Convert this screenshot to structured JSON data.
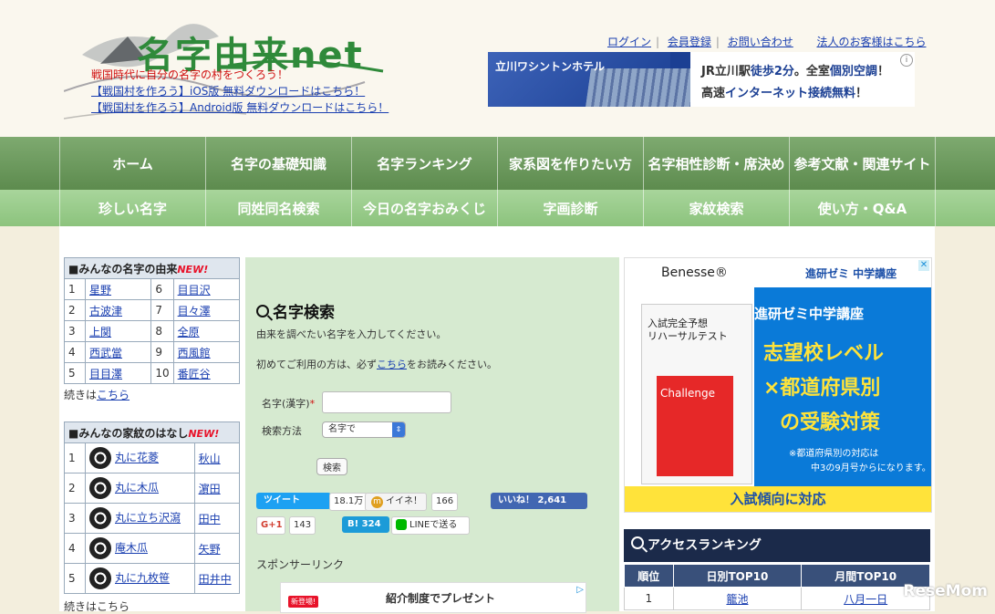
{
  "header": {
    "logo_text": "名字由来net",
    "promo_red": "戦国時代に自分の名字の村をつくろう！",
    "promo_ios": "【戦国村を作ろう】iOS版 無料ダウンロードはこちら！",
    "promo_android": "【戦国村を作ろう】Android版 無料ダウンロードはこちら！",
    "links": [
      "ログイン",
      "会員登録",
      "お問い合わせ",
      "法人のお客様はこちら"
    ],
    "banner": {
      "hotel": "立川ワシントンホテル",
      "line1_a": "JR立川駅",
      "line1_b": "徒歩2分",
      "line1_c": "。全室",
      "line1_d": "個別空調",
      "line1_e": "！",
      "line2_a": "高速",
      "line2_b": "インターネット接続無料",
      "line2_c": "！"
    }
  },
  "nav_main": [
    "ホーム",
    "名字の基礎知識",
    "名字ランキング",
    "家系図を作りたい方",
    "名字相性診断・席決め",
    "参考文献・関連サイト"
  ],
  "nav_sub": [
    "珍しい名字",
    "同姓同名検索",
    "今日の名字おみくじ",
    "字画診断",
    "家紋検索",
    "使い方・Q&A"
  ],
  "origins": {
    "title": "■みんなの名字の由来",
    "new_badge": "NEW!",
    "rows": [
      [
        "1",
        "星野",
        "6",
        "目目沢"
      ],
      [
        "2",
        "古波津",
        "7",
        "目々澤"
      ],
      [
        "3",
        "上関",
        "8",
        "全原"
      ],
      [
        "4",
        "西武當",
        "9",
        "西風館"
      ],
      [
        "5",
        "目目澤",
        "10",
        "番匠谷"
      ]
    ],
    "more": "続きは",
    "more_link": "こちら"
  },
  "kamon": {
    "title": "■みんなの家紋のはなし",
    "new_badge": "NEW!",
    "rows": [
      [
        "1",
        "丸に花菱",
        "秋山"
      ],
      [
        "2",
        "丸に木瓜",
        "濵田"
      ],
      [
        "3",
        "丸に立ち沢瀉",
        "田中"
      ],
      [
        "4",
        "庵木瓜",
        "矢野"
      ],
      [
        "5",
        "丸に九枚笹",
        "田井中"
      ]
    ],
    "more": "続きはこちら"
  },
  "search": {
    "title": "名字検索",
    "desc1": "由来を調べたい名字を入力してください。",
    "desc2_a": "初めてご利用の方は、必ず",
    "desc2_link": "こちら",
    "desc2_b": "をお読みください。",
    "label_name": "名字(漢字)",
    "required": "*",
    "label_method": "検索方法",
    "method_value": "名字で",
    "button": "検索"
  },
  "social": {
    "tweet": "ツイート",
    "tweet_count": "18.1万",
    "iine": "イイネ！",
    "iine_count": "166",
    "fb": "いいね！ 2,641",
    "gplus": "G+1",
    "gplus_count": "143",
    "hatena": "B! 324",
    "line": "LINEで送る"
  },
  "sponsor": {
    "label": "スポンサーリンク",
    "badge": "新登場!",
    "ad_text": "紹介制度でプレゼント"
  },
  "right_ad": {
    "benesse": "Benesse®",
    "shinken_top": "進研ゼミ 中学講座",
    "book1": "入試完全予想",
    "book2": "リハーサルテスト",
    "book_red": "Challenge",
    "headline1": "進研ゼミ中学講座",
    "headline2": "志望校レベル",
    "headline3": "×都道府県別",
    "headline4": "の受験対策",
    "note1": "※都道府県別の対応は",
    "note2": "中3の9月号からになります。",
    "bottom": "入試傾向に対応"
  },
  "ranking": {
    "title": "アクセスランキング",
    "headers": [
      "順位",
      "日別TOP10",
      "月間TOP10"
    ],
    "rows": [
      [
        "1",
        "籠池",
        "八月一日"
      ]
    ]
  },
  "watermark": "ReseMom"
}
